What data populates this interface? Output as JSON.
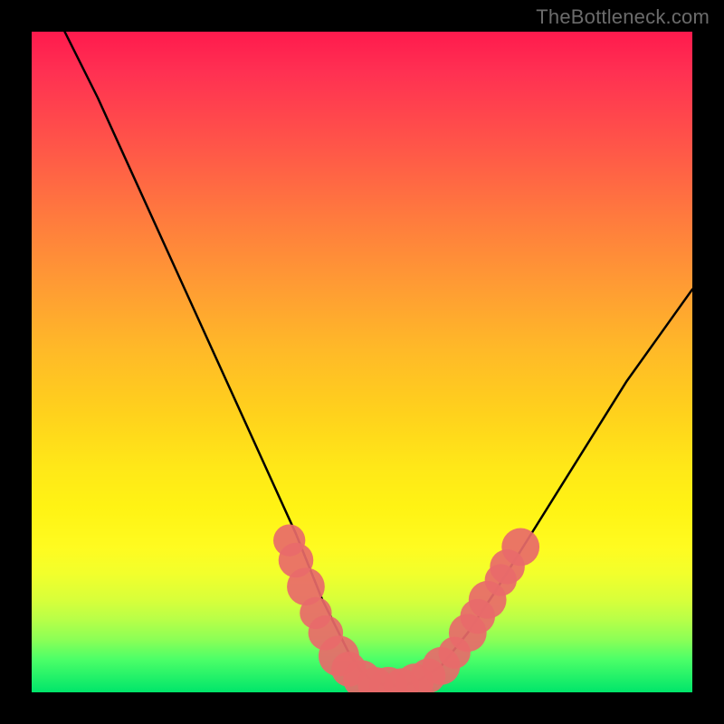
{
  "watermark": "TheBottleneck.com",
  "colors": {
    "frame": "#000000",
    "curve": "#000000",
    "markers_fill": "#e86a6a",
    "markers_stroke": "#cc5555",
    "gradient_top": "#ff1a4d",
    "gradient_bottom": "#00e56a"
  },
  "chart_data": {
    "type": "line",
    "title": "",
    "xlabel": "",
    "ylabel": "",
    "xlim": [
      0,
      100
    ],
    "ylim": [
      0,
      100
    ],
    "grid": false,
    "legend": false,
    "series": [
      {
        "name": "curve",
        "x": [
          5,
          10,
          15,
          20,
          25,
          30,
          35,
          40,
          44,
          48,
          50,
          52,
          54,
          56,
          58,
          62,
          66,
          70,
          75,
          80,
          85,
          90,
          95,
          100
        ],
        "y": [
          100,
          90,
          79,
          68,
          57,
          46,
          35,
          24,
          14,
          6,
          3,
          1.5,
          1,
          1,
          1.5,
          4,
          9,
          15,
          23,
          31,
          39,
          47,
          54,
          61
        ]
      }
    ],
    "markers": [
      {
        "x": 39,
        "y": 23,
        "r": 2.2
      },
      {
        "x": 40,
        "y": 20,
        "r": 2.4
      },
      {
        "x": 41.5,
        "y": 16,
        "r": 2.6
      },
      {
        "x": 43,
        "y": 12,
        "r": 2.2
      },
      {
        "x": 44.5,
        "y": 9,
        "r": 2.4
      },
      {
        "x": 46.5,
        "y": 5.5,
        "r": 2.8
      },
      {
        "x": 48,
        "y": 3.5,
        "r": 2.4
      },
      {
        "x": 50,
        "y": 2,
        "r": 2.6
      },
      {
        "x": 52,
        "y": 1.2,
        "r": 2.4
      },
      {
        "x": 54,
        "y": 1,
        "r": 2.6
      },
      {
        "x": 56,
        "y": 1,
        "r": 2.4
      },
      {
        "x": 58,
        "y": 1.5,
        "r": 2.6
      },
      {
        "x": 60,
        "y": 2.5,
        "r": 2.4
      },
      {
        "x": 62,
        "y": 4,
        "r": 2.6
      },
      {
        "x": 64,
        "y": 6,
        "r": 2.2
      },
      {
        "x": 66,
        "y": 9,
        "r": 2.6
      },
      {
        "x": 67.5,
        "y": 11.5,
        "r": 2.4
      },
      {
        "x": 69,
        "y": 14,
        "r": 2.6
      },
      {
        "x": 71,
        "y": 17,
        "r": 2.2
      },
      {
        "x": 72,
        "y": 19,
        "r": 2.4
      },
      {
        "x": 74,
        "y": 22,
        "r": 2.6
      }
    ]
  }
}
